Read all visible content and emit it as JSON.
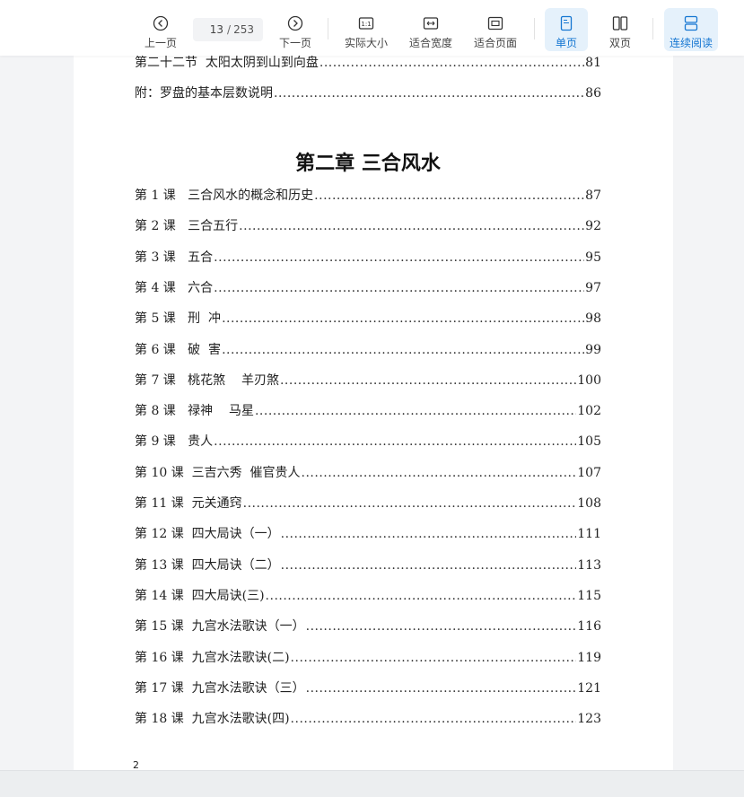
{
  "toolbar": {
    "prev": "上一页",
    "next": "下一页",
    "current_page": "13",
    "total_pages": "253",
    "actual_size": "实际大小",
    "fit_width": "适合宽度",
    "fit_page": "适合页面",
    "single_page": "单页",
    "double_page": "双页",
    "continuous": "连续阅读",
    "accent_color": "#1677d2"
  },
  "page": {
    "top_entries": [
      {
        "title": "第二十二节  太阳太阴到山到向盘",
        "page": "81"
      },
      {
        "title": "附：罗盘的基本层数说明",
        "page": "86"
      }
    ],
    "chapter_title": "第二章  三合风水",
    "lessons": [
      {
        "title": "第 1 课   三合风水的概念和历史",
        "page": "87"
      },
      {
        "title": "第 2 课   三合五行",
        "page": "92"
      },
      {
        "title": "第 3 课   五合",
        "page": "95"
      },
      {
        "title": "第 4 课   六合",
        "page": "97"
      },
      {
        "title": "第 5 课   刑  冲",
        "page": "98"
      },
      {
        "title": "第 6 课   破  害",
        "page": "99"
      },
      {
        "title": "第 7 课   桃花煞    羊刃煞",
        "page": "100"
      },
      {
        "title": "第 8 课   禄神    马星",
        "page": "102"
      },
      {
        "title": "第 9 课   贵人",
        "page": "105"
      },
      {
        "title": "第 10 课  三吉六秀  催官贵人",
        "page": "107"
      },
      {
        "title": "第 11 课  元关通窍",
        "page": "108"
      },
      {
        "title": "第 12 课  四大局诀（一）",
        "page": "111"
      },
      {
        "title": "第 13 课  四大局诀（二）",
        "page": "113"
      },
      {
        "title": "第 14 课  四大局诀(三)",
        "page": "115"
      },
      {
        "title": "第 15 课  九宫水法歌诀（一）",
        "page": "116"
      },
      {
        "title": "第 16 课  九宫水法歌诀(二)",
        "page": "119"
      },
      {
        "title": "第 17 课  九宫水法歌诀（三）",
        "page": "121"
      },
      {
        "title": "第 18 课  九宫水法歌诀(四)",
        "page": "123"
      }
    ],
    "folio": "2"
  }
}
